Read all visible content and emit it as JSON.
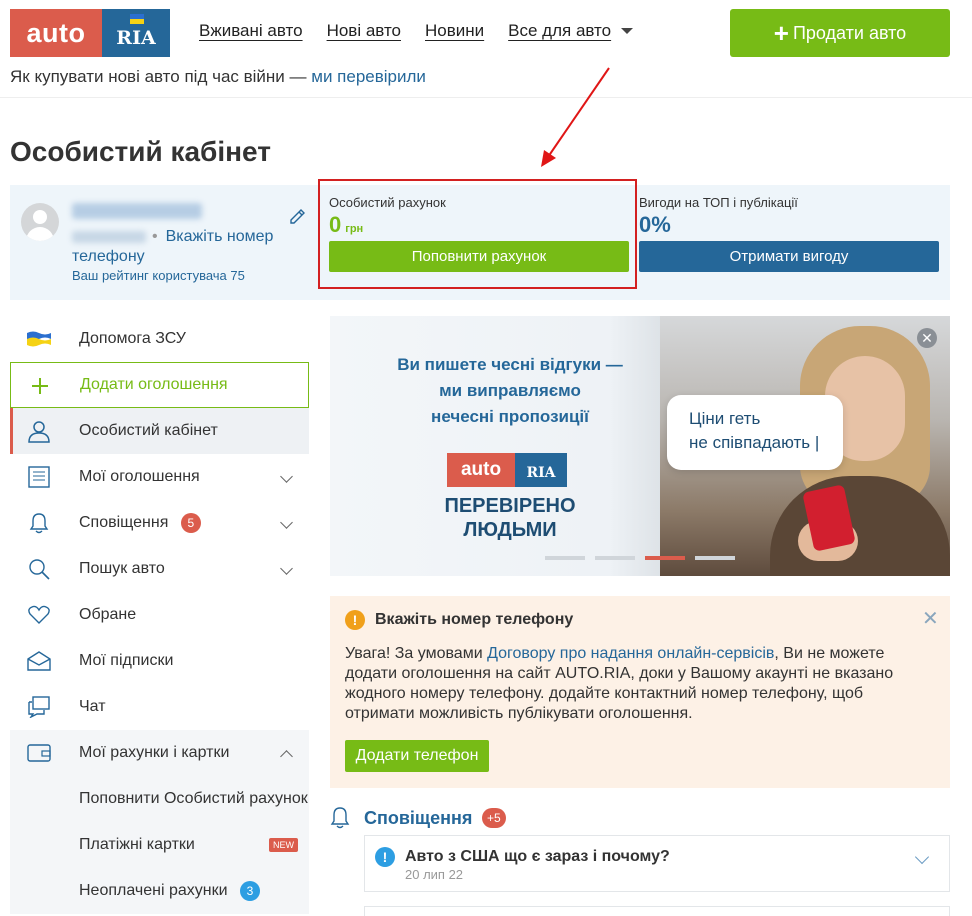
{
  "header": {
    "logo_auto": "auto",
    "logo_ria": "RIA",
    "nav": [
      "Вживані авто",
      "Нові авто",
      "Новини",
      "Все для авто"
    ],
    "sell_button": "Продати авто",
    "promo_text": "Як купувати нові авто під час війни —",
    "promo_link": "ми перевірили"
  },
  "page_title": "Особистий кабінет",
  "profile": {
    "phone_link": "Вкажіть номер телефону",
    "rating": "Ваш рейтинг користувача 75"
  },
  "account": {
    "label": "Особистий рахунок",
    "value": "0",
    "currency": "грн",
    "topup_button": "Поповнити рахунок"
  },
  "benefits": {
    "label": "Вигоди на ТОП і публікації",
    "value": "0%",
    "button": "Отримати вигоду"
  },
  "sidebar": {
    "items": [
      {
        "label": "Допомога ЗСУ",
        "icon": "ukraine-flag-icon"
      },
      {
        "label": "Додати оголошення",
        "icon": "plus-icon"
      },
      {
        "label": "Особистий кабінет",
        "icon": "user-icon"
      },
      {
        "label": "Мої оголошення",
        "icon": "list-icon"
      },
      {
        "label": "Сповіщення",
        "icon": "bell-icon",
        "badge": "5"
      },
      {
        "label": "Пошук авто",
        "icon": "search-icon"
      },
      {
        "label": "Обране",
        "icon": "heart-icon"
      },
      {
        "label": "Мої підписки",
        "icon": "envelope-icon"
      },
      {
        "label": "Чат",
        "icon": "chat-icon"
      },
      {
        "label": "Мої рахунки і картки",
        "icon": "wallet-icon"
      }
    ],
    "sub_items": [
      {
        "label": "Поповнити Особистий рахунок"
      },
      {
        "label": "Платіжні картки",
        "badge": "NEW"
      },
      {
        "label": "Неоплачені рахунки",
        "badge": "3"
      }
    ]
  },
  "banner": {
    "headline": "Ви пишете чесні відгуки — ми виправляємо нечесні пропозиції",
    "headline_lines": [
      "Ви пишете чесні відгуки —",
      "ми виправляємо",
      "нечесні пропозиції"
    ],
    "logo_auto": "auto",
    "logo_ria": "RIA",
    "verified_lines": [
      "ПЕРЕВІРЕНО",
      "ЛЮДЬМИ"
    ],
    "bubble_lines": [
      "Ціни геть",
      "не співпадають |"
    ],
    "active_slide": 3,
    "slides": 4
  },
  "alert": {
    "title": "Вкажіть номер телефону",
    "text_before": "Увага! За умовами ",
    "link": "Договору про надання онлайн-сервісів",
    "text_after": ", Ви не можете додати оголошення на сайт AUTO.RIA, доки у Вашому акаунті не вказано жодного номеру телефону. додайте контактний номер телефону, щоб отримати можливість публікувати оголошення.",
    "button": "Додати телефон"
  },
  "notifications": {
    "title": "Сповіщення",
    "badge": "+5",
    "items": [
      {
        "title": "Авто з США що є зараз і почому?",
        "date": "20 лип 22"
      }
    ]
  },
  "colors": {
    "brand_red": "#db5c4c",
    "brand_blue": "#256799",
    "green": "#77bb16",
    "highlight_box": "#d32020"
  }
}
